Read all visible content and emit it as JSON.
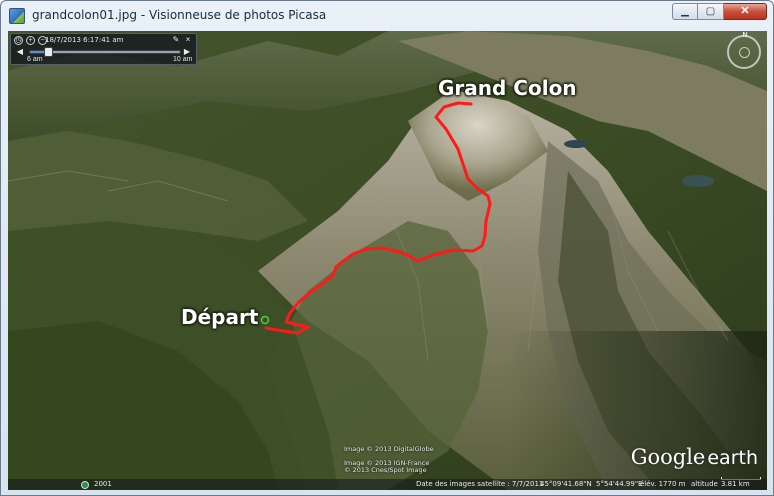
{
  "window": {
    "title": "grandcolon01.jpg - Visionneuse de photos Picasa",
    "minimize_label": "▁",
    "maximize_label": "▢",
    "close_label": "✕"
  },
  "time_slider": {
    "timestamp": "18/7/2013   6:17:41 am",
    "start_label": "6 am",
    "end_label": "10 am",
    "position_fraction": 0.12
  },
  "map": {
    "peak_label": "Grand Colon",
    "start_label": "Départ",
    "route_color": "#ff1a1a",
    "credits": [
      "Image © 2013 DigitalGlobe",
      "Image © 2013 IGN-France",
      "© 2013 Cnes/Spot Image"
    ],
    "logo_google": "Google",
    "logo_earth": "earth",
    "compass_north": "N"
  },
  "status": {
    "year": "2001",
    "imagery_date": "Date des images satellite : 7/7/2011",
    "latitude": "45°09'41.68\"N",
    "longitude": "5°54'44.99\"E",
    "elevation": "élév. 1770 m",
    "altitude_label": "altitude",
    "altitude_value": "3.81 km"
  },
  "icons": {
    "app": "picasa-photo-icon",
    "time": [
      "clock-icon",
      "zoom-in-icon",
      "zoom-out-icon"
    ],
    "compass": "compass-icon"
  }
}
